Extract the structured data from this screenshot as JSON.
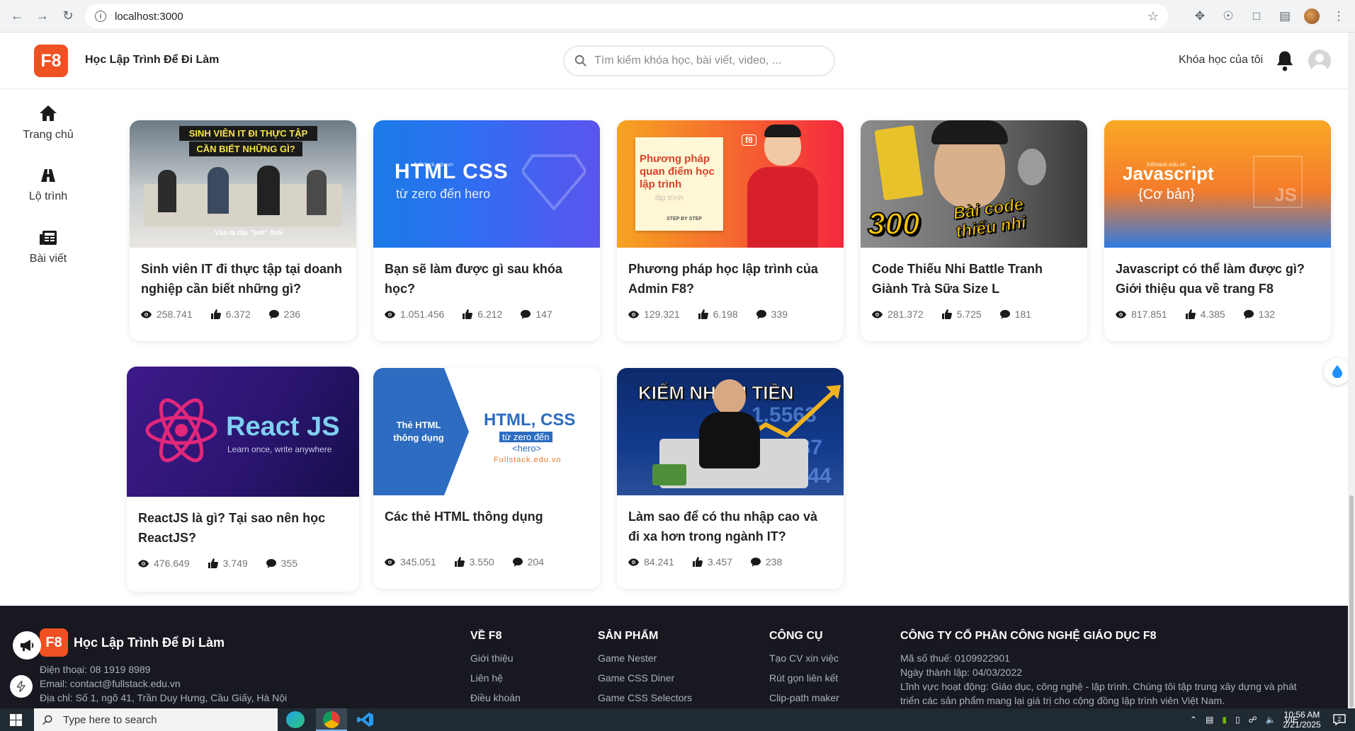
{
  "browser": {
    "url": "localhost:3000"
  },
  "header": {
    "logo_text": "F8",
    "brand": "Học Lập Trình Để Đi Làm",
    "search_placeholder": "Tìm kiếm khóa học, bài viết, video, ...",
    "my_courses": "Khóa học của tôi"
  },
  "sidebar": {
    "items": [
      {
        "label": "Trang chủ",
        "icon": "home-icon"
      },
      {
        "label": "Lộ trình",
        "icon": "road-icon"
      },
      {
        "label": "Bài viết",
        "icon": "newspaper-icon"
      }
    ]
  },
  "thumbs": {
    "t1_caption_1": "SINH VIÊN IT ĐI THỰC TẬP",
    "t1_caption_2": "CẦN BIẾT NHỮNG GÌ?",
    "t1_sub": "Vào là tập \"bot\" thôi",
    "t2_site": "fullstack.edu.vn",
    "t2_title": "HTML CSS",
    "t2_sub": "từ zero đến hero",
    "t3_text": "Phương pháp quan điểm học lập trình",
    "t3_sub1": "lập trình",
    "t3_sub2": "STEP BY STEP",
    "t3_badge": "f8",
    "t4_num": "300",
    "t4_text": "Bài code thiếu nhi",
    "t5_site": "fullstack.edu.vn",
    "t5_title": "Javascript",
    "t5_sub": "{Cơ bản}",
    "t5_js": "JS",
    "t6_title": "React JS",
    "t6_sub": "Learn once, write anywhere",
    "t7_left": "Thẻ HTML thông dụng",
    "t7_title": "HTML, CSS",
    "t7_sub1": "từ zero đến",
    "t7_sub2": "<hero>",
    "t7_site": "Fullstack.edu.vn",
    "t8_title": "KIẾM NHIỀU TIỀN",
    "t8_num1": "1.5563",
    "t8_num2": "287",
    "t8_num3": "2344"
  },
  "posts": [
    {
      "title": "Sinh viên IT đi thực tập tại doanh nghiệp cần biết những gì?",
      "views": "258.741",
      "likes": "6.372",
      "comments": "236"
    },
    {
      "title": "Bạn sẽ làm được gì sau khóa học?",
      "views": "1.051.456",
      "likes": "6.212",
      "comments": "147"
    },
    {
      "title": "Phương pháp học lập trình của Admin F8?",
      "views": "129.321",
      "likes": "6.198",
      "comments": "339"
    },
    {
      "title": "Code Thiếu Nhi Battle Tranh Giành Trà Sữa Size L",
      "views": "281.372",
      "likes": "5.725",
      "comments": "181"
    },
    {
      "title": "Javascript có thể làm được gì? Giới thiệu qua về trang F8",
      "views": "817.851",
      "likes": "4.385",
      "comments": "132"
    },
    {
      "title": "ReactJS là gì? Tại sao nên học ReactJS?",
      "views": "476.649",
      "likes": "3.749",
      "comments": "355"
    },
    {
      "title": "Các thẻ HTML thông dụng",
      "views": "345.051",
      "likes": "3.550",
      "comments": "204"
    },
    {
      "title": "Làm sao để có thu nhập cao và đi xa hơn trong ngành IT?",
      "views": "84.241",
      "likes": "3.457",
      "comments": "238"
    }
  ],
  "footer": {
    "logo_text": "F8",
    "brand": "Học Lập Trình Để Đi Làm",
    "phone": "Điện thoại: 08 1919 8989",
    "email": "Email: contact@fullstack.edu.vn",
    "address": "Địa chỉ: Số 1, ngõ 41, Trần Duy Hưng, Cầu Giấy, Hà Nội",
    "col_about": {
      "title": "VỀ F8",
      "links": [
        "Giới thiệu",
        "Liên hệ",
        "Điều khoản"
      ]
    },
    "col_products": {
      "title": "SẢN PHẨM",
      "links": [
        "Game Nester",
        "Game CSS Diner",
        "Game CSS Selectors"
      ]
    },
    "col_tools": {
      "title": "CÔNG CỤ",
      "links": [
        "Tạo CV xin việc",
        "Rút gọn liên kết",
        "Clip-path maker"
      ]
    },
    "company": {
      "title": "CÔNG TY CỔ PHẦN CÔNG NGHỆ GIÁO DỤC F8",
      "tax": "Mã số thuế: 0109922901",
      "founded": "Ngày thành lập: 04/03/2022",
      "field": "Lĩnh vực hoạt động: Giáo dục, công nghệ - lập trình. Chúng tôi tập trung xây dựng và phát triển các sản phẩm mang lại giá trị cho cộng đồng lập trình viên Việt Nam."
    }
  },
  "taskbar": {
    "search_placeholder": "Type here to search",
    "lang": "VIE",
    "time": "10:56 AM",
    "date": "2/21/2025"
  }
}
